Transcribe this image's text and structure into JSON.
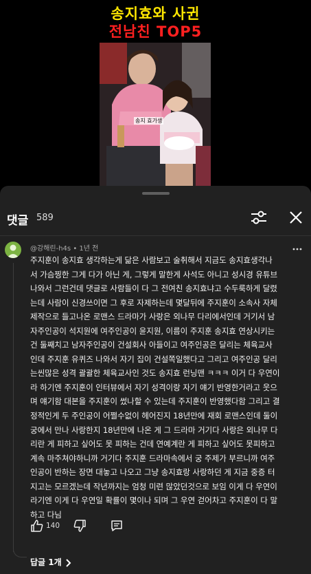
{
  "video": {
    "title_line1": "송지효와 사귄",
    "title_line2": "전남친 TOP5",
    "caption": "송지 효가생"
  },
  "comments_header": {
    "title": "댓글",
    "count": "589"
  },
  "comment": {
    "author": "@강해린-h4s",
    "separator": "•",
    "time": "1년 전",
    "text": "주지훈이 송지효 생각하는게 닮은 사람보고 술취해서 지금도 송지효생각나\n서 가슴찡한 그게 다가 아닌 게, 그렇게 말한게 사석도 아니고 성시경 유튜브\n나와서 그런건데 댓글로 사람들이 다 그 전여친 송지효냐고 수두룩하게 달렸\n는데 사람이 신경쓰이면 그 후로 자제하는데 몇달뒤에 주지훈이 소속사 자체\n제작으로 들고나온 로맨스 드라마가 사랑은 외나무 다리에서인데 거기서 남\n자주인공이 석지원에 여주인공이 윤지원, 이름이 주지훈 송지효 연상시키는\n건 둘째치고 남자주인공이 건설회사 아들이고 여주인공은 달리는 체육교사\n인데 주지훈 유퀴즈 나와서 자기 집이 건설쪽일했다고 그리고 여주인공 달리\n는씬많은 성격 괄괄한 체육교사인 것도 송지효 런닝맨 ㅋㅋㅋ 이거 다 우연이\n라 하기엔 주지훈이 인터뷰에서 자기 성격이랑 자기 얘기 반영한거라고 웃으\n며 얘기함 대본을 주지훈이 썼나할 수 있는데 주지훈이 반영했다함 그리고 결\n정적인게 두 주인공이 어쩔수없이 헤어진지 18년만에 재회 로맨스인데 둘이\n궁에서 만나 사랑한지 18년만에 나온 게 그 드라마 거기다 사랑은 외나무 다\n리란 게 피하고 싶어도 못 피하는 건데 연예계란 게 피하고 싶어도 못피하고\n계속 마주쳐야하니까 거기다 주지훈 드라마속에서 궁 주제가 부르니까 여주\n인공이 반하는 장면 대놓고 나오고 그냥 송지효랑 사랑하던 게 지금 중증 터\n지고는 모르겠는데 작년까지는 엄청 미련 많았던것으로 보임 이게 다 우연이\n라기엔 이게 다 우연일 확률이 몇이나 되며 그 우연 걷어차고 주지훈이 다 말\n하고 다님",
    "like_count": "140",
    "replies_label": "답글 1개"
  },
  "colors": {
    "title_yellow": "#ffe600",
    "title_red": "#ff2020",
    "panel_bg": "#212121",
    "avatar_green": "#7cb342"
  },
  "icons": [
    "filter-icon",
    "close-icon",
    "more-vert-icon",
    "thumbs-up-icon",
    "thumbs-down-icon",
    "reply-icon",
    "chevron-right-icon"
  ]
}
